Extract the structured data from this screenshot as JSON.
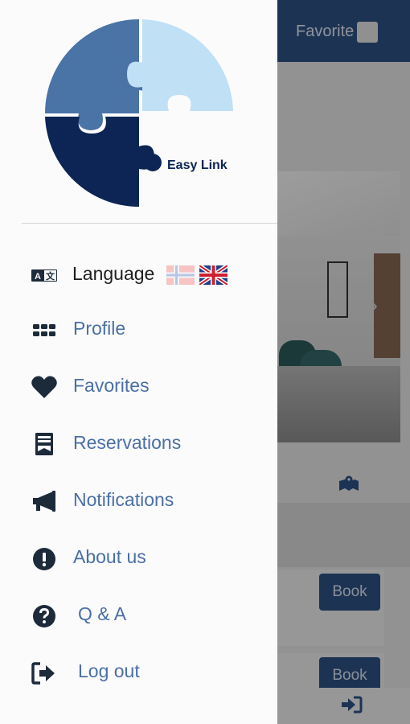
{
  "background": {
    "header": {
      "favorite_label": "Favorite"
    },
    "book_buttons": [
      "Book",
      "Book"
    ]
  },
  "drawer": {
    "logo_text": "Easy Link",
    "menu": [
      {
        "label": "Language",
        "icon": "language-icon"
      },
      {
        "label": "Profile",
        "icon": "grid-icon"
      },
      {
        "label": "Favorites",
        "icon": "heart-icon"
      },
      {
        "label": "Reservations",
        "icon": "receipt-icon"
      },
      {
        "label": "Notifications",
        "icon": "megaphone-icon"
      },
      {
        "label": "About us",
        "icon": "info-icon"
      },
      {
        "label": "Q & A",
        "icon": "question-icon"
      },
      {
        "label": "Log out",
        "icon": "logout-icon"
      }
    ]
  },
  "colors": {
    "primary": "#2e5388",
    "menu_text": "#4a6fa5",
    "icon_dark": "#1c2a3a",
    "logo_light": "#bfe0f5",
    "logo_mid": "#4a73a6",
    "logo_dark": "#0c2554"
  }
}
